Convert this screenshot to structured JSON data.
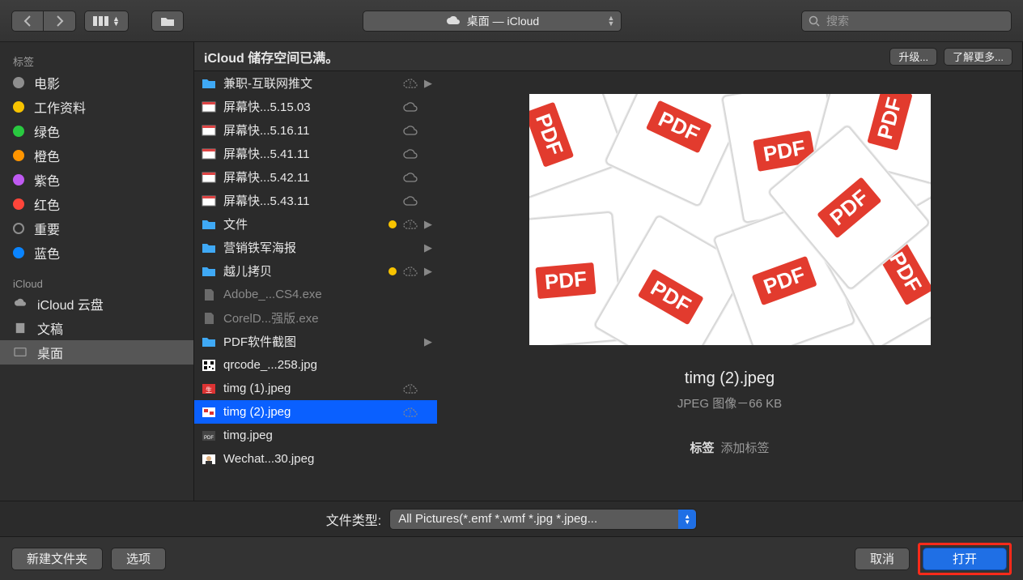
{
  "toolbar": {
    "path_location": "桌面 — iCloud",
    "search_placeholder": "搜索"
  },
  "banner": {
    "text": "iCloud 储存空间已满。",
    "upgrade": "升级...",
    "learn_more": "了解更多..."
  },
  "sidebar": {
    "section_tags": "标签",
    "tags": [
      {
        "label": "电影",
        "color": "#8e8e8e"
      },
      {
        "label": "工作资料",
        "color": "#f7c300"
      },
      {
        "label": "绿色",
        "color": "#29c940"
      },
      {
        "label": "橙色",
        "color": "#ff9500"
      },
      {
        "label": "紫色",
        "color": "#bf5af2"
      },
      {
        "label": "红色",
        "color": "#ff453a"
      },
      {
        "label": "重要",
        "color": "transparent",
        "outline": true
      },
      {
        "label": "蓝色",
        "color": "#0a84ff"
      }
    ],
    "section_icloud": "iCloud",
    "icloud_items": [
      {
        "label": "iCloud 云盘",
        "icon": "cloud"
      },
      {
        "label": "文稿",
        "icon": "doc"
      },
      {
        "label": "桌面",
        "icon": "desktop",
        "selected": true
      }
    ]
  },
  "files": [
    {
      "name": "兼职-互联网推文",
      "type": "folder",
      "cloud": "warn",
      "arrow": true
    },
    {
      "name": "屏幕快...5.15.03",
      "type": "screenshot",
      "cloud": "cloud"
    },
    {
      "name": "屏幕快...5.16.11",
      "type": "screenshot",
      "cloud": "cloud"
    },
    {
      "name": "屏幕快...5.41.11",
      "type": "screenshot",
      "cloud": "cloud"
    },
    {
      "name": "屏幕快...5.42.11",
      "type": "screenshot",
      "cloud": "cloud"
    },
    {
      "name": "屏幕快...5.43.11",
      "type": "screenshot",
      "cloud": "cloud"
    },
    {
      "name": "文件",
      "type": "folder",
      "badge": true,
      "cloud": "warn",
      "arrow": true
    },
    {
      "name": "营销铁军海报",
      "type": "folder",
      "arrow": true
    },
    {
      "name": "越儿拷贝",
      "type": "folder",
      "badge": true,
      "cloud": "warn",
      "arrow": true
    },
    {
      "name": "Adobe_...CS4.exe",
      "type": "exe",
      "dim": true
    },
    {
      "name": "CorelD...强版.exe",
      "type": "exe",
      "dim": true
    },
    {
      "name": "PDF软件截图",
      "type": "folder",
      "arrow": true
    },
    {
      "name": "qrcode_...258.jpg",
      "type": "qr"
    },
    {
      "name": "timg (1).jpeg",
      "type": "img-red",
      "cloud": "warn"
    },
    {
      "name": "timg (2).jpeg",
      "type": "img-wr",
      "cloud": "warn",
      "selected": true
    },
    {
      "name": "timg.jpeg",
      "type": "img-pdf"
    },
    {
      "name": "Wechat...30.jpeg",
      "type": "img-face"
    }
  ],
  "preview": {
    "name": "timg (2).jpeg",
    "meta": "JPEG 图像－66 KB",
    "tags_label": "标签",
    "tags_placeholder": "添加标签"
  },
  "typebar": {
    "label": "文件类型:",
    "value": "All Pictures(*.emf *.wmf *.jpg *.jpeg..."
  },
  "footer": {
    "new_folder": "新建文件夹",
    "options": "选项",
    "cancel": "取消",
    "open": "打开"
  }
}
